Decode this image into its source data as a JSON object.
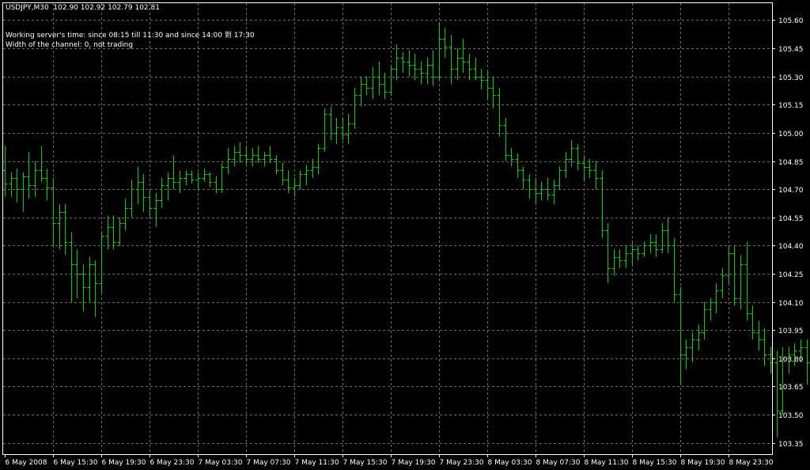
{
  "header": {
    "symbol_line": "USDJPY,M30  102.90 102.92 102.79 102.81",
    "server_time_line": "Working server's time: since 08:15 till 11:30 and since 14:00 到 17:30",
    "channel_line": "Width of the channel: 0, not trading"
  },
  "colors": {
    "background": "#000000",
    "grid": "#6b6b6b",
    "bars": "#00d000",
    "text": "#ffffff",
    "frame": "#ffffff"
  },
  "chart_data": {
    "type": "ohlc",
    "symbol": "USDJPY",
    "timeframe": "M30",
    "grid": true,
    "y_axis_side": "right",
    "ylim": [
      103.29,
      105.69
    ],
    "y_ticks": [
      "105.60",
      "105.45",
      "105.30",
      "105.15",
      "105.00",
      "104.85",
      "104.70",
      "104.55",
      "104.40",
      "104.25",
      "104.10",
      "103.95",
      "103.80",
      "103.65",
      "103.50",
      "103.35"
    ],
    "x_ticks": [
      "6 May 2008",
      "6 May 15:30",
      "6 May 19:30",
      "6 May 23:30",
      "7 May 03:30",
      "7 May 07:30",
      "7 May 11:30",
      "7 May 15:30",
      "7 May 19:30",
      "7 May 23:30",
      "8 May 03:30",
      "8 May 07:30",
      "8 May 11:30",
      "8 May 15:30",
      "8 May 19:30",
      "8 May 23:30"
    ],
    "bars_per_tick": 8,
    "bars": [
      [
        104.8,
        104.93,
        104.66,
        104.73
      ],
      [
        104.73,
        104.79,
        104.66,
        104.76
      ],
      [
        104.76,
        104.81,
        104.63,
        104.7
      ],
      [
        104.7,
        104.79,
        104.58,
        104.77
      ],
      [
        104.77,
        104.9,
        104.65,
        104.72
      ],
      [
        104.72,
        104.85,
        104.66,
        104.8
      ],
      [
        104.8,
        104.93,
        104.74,
        104.76
      ],
      [
        104.76,
        104.81,
        104.64,
        104.71
      ],
      [
        104.71,
        104.76,
        104.4,
        104.52
      ],
      [
        104.52,
        104.62,
        104.38,
        104.58
      ],
      [
        104.58,
        104.62,
        104.35,
        104.42
      ],
      [
        104.42,
        104.47,
        104.1,
        104.3
      ],
      [
        104.3,
        104.38,
        104.12,
        104.25
      ],
      [
        104.25,
        104.3,
        104.05,
        104.18
      ],
      [
        104.18,
        104.34,
        104.1,
        104.3
      ],
      [
        104.3,
        104.32,
        104.02,
        104.2
      ],
      [
        104.2,
        104.47,
        104.15,
        104.45
      ],
      [
        104.45,
        104.56,
        104.38,
        104.5
      ],
      [
        104.5,
        104.56,
        104.38,
        104.42
      ],
      [
        104.42,
        104.55,
        104.4,
        104.52
      ],
      [
        104.52,
        104.65,
        104.48,
        104.6
      ],
      [
        104.6,
        104.75,
        104.55,
        104.7
      ],
      [
        104.7,
        104.82,
        104.62,
        104.74
      ],
      [
        104.74,
        104.78,
        104.58,
        104.66
      ],
      [
        104.66,
        104.7,
        104.55,
        104.6
      ],
      [
        104.6,
        104.68,
        104.5,
        104.64
      ],
      [
        104.64,
        104.76,
        104.6,
        104.72
      ],
      [
        104.72,
        104.79,
        104.64,
        104.76
      ],
      [
        104.76,
        104.88,
        104.7,
        104.74
      ],
      [
        104.74,
        104.8,
        104.68,
        104.76
      ],
      [
        104.76,
        104.8,
        104.72,
        104.78
      ],
      [
        104.78,
        104.8,
        104.73,
        104.75
      ],
      [
        104.75,
        104.79,
        104.69,
        104.76
      ],
      [
        104.76,
        104.81,
        104.74,
        104.78
      ],
      [
        104.78,
        104.79,
        104.71,
        104.74
      ],
      [
        104.74,
        104.77,
        104.68,
        104.7
      ],
      [
        104.7,
        104.84,
        104.68,
        104.82
      ],
      [
        104.82,
        104.92,
        104.78,
        104.86
      ],
      [
        104.86,
        104.93,
        104.82,
        104.9
      ],
      [
        104.9,
        104.95,
        104.84,
        104.88
      ],
      [
        104.88,
        104.93,
        104.83,
        104.86
      ],
      [
        104.86,
        104.92,
        104.82,
        104.88
      ],
      [
        104.88,
        104.93,
        104.84,
        104.86
      ],
      [
        104.86,
        104.9,
        104.82,
        104.88
      ],
      [
        104.88,
        104.93,
        104.84,
        104.86
      ],
      [
        104.86,
        104.88,
        104.78,
        104.8
      ],
      [
        104.8,
        104.84,
        104.72,
        104.75
      ],
      [
        104.75,
        104.8,
        104.68,
        104.71
      ],
      [
        104.71,
        104.76,
        104.66,
        104.72
      ],
      [
        104.72,
        104.8,
        104.7,
        104.78
      ],
      [
        104.78,
        104.83,
        104.72,
        104.8
      ],
      [
        104.8,
        104.86,
        104.76,
        104.82
      ],
      [
        104.82,
        104.94,
        104.78,
        104.92
      ],
      [
        104.92,
        105.13,
        104.9,
        105.1
      ],
      [
        105.1,
        105.14,
        104.96,
        105.0
      ],
      [
        105.0,
        105.08,
        104.94,
        105.03
      ],
      [
        105.03,
        105.08,
        104.96,
        104.99
      ],
      [
        104.99,
        105.1,
        104.94,
        105.05
      ],
      [
        105.05,
        105.24,
        105.02,
        105.2
      ],
      [
        105.2,
        105.3,
        105.14,
        105.26
      ],
      [
        105.26,
        105.3,
        105.2,
        105.24
      ],
      [
        105.24,
        105.35,
        105.18,
        105.3
      ],
      [
        105.3,
        105.38,
        105.2,
        105.26
      ],
      [
        105.26,
        105.32,
        105.18,
        105.22
      ],
      [
        105.22,
        105.36,
        105.2,
        105.34
      ],
      [
        105.34,
        105.47,
        105.28,
        105.4
      ],
      [
        105.4,
        105.43,
        105.32,
        105.38
      ],
      [
        105.38,
        105.44,
        105.3,
        105.36
      ],
      [
        105.36,
        105.42,
        105.28,
        105.34
      ],
      [
        105.34,
        105.38,
        105.26,
        105.32
      ],
      [
        105.32,
        105.4,
        105.26,
        105.36
      ],
      [
        105.36,
        105.44,
        105.25,
        105.3
      ],
      [
        105.3,
        105.59,
        105.28,
        105.5
      ],
      [
        105.5,
        105.56,
        105.4,
        105.46
      ],
      [
        105.46,
        105.52,
        105.26,
        105.34
      ],
      [
        105.34,
        105.45,
        105.28,
        105.4
      ],
      [
        105.4,
        105.5,
        105.32,
        105.38
      ],
      [
        105.38,
        105.42,
        105.28,
        105.34
      ],
      [
        105.34,
        105.4,
        105.28,
        105.3
      ],
      [
        105.3,
        105.34,
        105.23,
        105.28
      ],
      [
        105.28,
        105.33,
        105.18,
        105.24
      ],
      [
        105.24,
        105.3,
        105.13,
        105.2
      ],
      [
        105.2,
        105.24,
        104.98,
        105.04
      ],
      [
        105.04,
        105.08,
        104.85,
        104.88
      ],
      [
        104.88,
        104.92,
        104.82,
        104.86
      ],
      [
        104.86,
        104.89,
        104.76,
        104.8
      ],
      [
        104.8,
        104.82,
        104.7,
        104.75
      ],
      [
        104.75,
        104.78,
        104.65,
        104.7
      ],
      [
        104.7,
        104.76,
        104.62,
        104.68
      ],
      [
        104.68,
        104.74,
        104.64,
        104.7
      ],
      [
        104.7,
        104.76,
        104.64,
        104.67
      ],
      [
        104.67,
        104.75,
        104.62,
        104.72
      ],
      [
        104.72,
        104.82,
        104.7,
        104.8
      ],
      [
        104.8,
        104.9,
        104.76,
        104.86
      ],
      [
        104.86,
        104.96,
        104.82,
        104.92
      ],
      [
        104.92,
        104.94,
        104.8,
        104.84
      ],
      [
        104.84,
        104.88,
        104.74,
        104.82
      ],
      [
        104.82,
        104.86,
        104.76,
        104.8
      ],
      [
        104.8,
        104.85,
        104.7,
        104.76
      ],
      [
        104.76,
        104.8,
        104.44,
        104.48
      ],
      [
        104.48,
        104.52,
        104.2,
        104.28
      ],
      [
        104.28,
        104.38,
        104.24,
        104.34
      ],
      [
        104.34,
        104.38,
        104.28,
        104.32
      ],
      [
        104.32,
        104.4,
        104.28,
        104.36
      ],
      [
        104.36,
        104.42,
        104.3,
        104.38
      ],
      [
        104.38,
        104.4,
        104.32,
        104.36
      ],
      [
        104.36,
        104.42,
        104.34,
        104.4
      ],
      [
        104.4,
        104.46,
        104.36,
        104.42
      ],
      [
        104.42,
        104.46,
        104.34,
        104.38
      ],
      [
        104.38,
        104.52,
        104.36,
        104.48
      ],
      [
        104.48,
        104.55,
        104.36,
        104.4
      ],
      [
        104.4,
        104.44,
        104.1,
        104.14
      ],
      [
        104.14,
        104.18,
        103.66,
        103.82
      ],
      [
        103.82,
        103.9,
        103.74,
        103.86
      ],
      [
        103.86,
        103.94,
        103.78,
        103.9
      ],
      [
        103.9,
        103.98,
        103.84,
        103.94
      ],
      [
        103.94,
        104.1,
        103.9,
        104.06
      ],
      [
        104.06,
        104.12,
        104.0,
        104.1
      ],
      [
        104.1,
        104.2,
        104.04,
        104.16
      ],
      [
        104.16,
        104.28,
        104.12,
        104.24
      ],
      [
        104.24,
        104.4,
        104.2,
        104.36
      ],
      [
        104.36,
        104.4,
        104.08,
        104.12
      ],
      [
        104.12,
        104.35,
        104.06,
        104.3
      ],
      [
        104.3,
        104.42,
        104.0,
        104.04
      ],
      [
        104.04,
        104.08,
        103.9,
        103.94
      ],
      [
        103.94,
        104.0,
        103.84,
        103.9
      ],
      [
        103.9,
        103.96,
        103.76,
        103.82
      ],
      [
        103.82,
        103.86,
        103.72,
        103.78
      ],
      [
        103.78,
        103.84,
        103.38,
        103.52
      ],
      [
        103.52,
        103.86,
        103.5,
        103.8
      ],
      [
        103.8,
        103.86,
        103.72,
        103.82
      ],
      [
        103.82,
        103.88,
        103.76,
        103.84
      ],
      [
        103.84,
        103.9,
        103.78,
        103.86
      ],
      [
        103.86,
        103.9,
        103.66,
        103.78
      ],
      [
        103.78,
        103.86,
        103.72,
        103.8
      ],
      [
        103.8,
        103.92,
        103.76,
        103.88
      ],
      [
        103.88,
        103.98,
        103.84,
        103.94
      ],
      [
        103.94,
        104.08,
        103.88,
        104.02
      ],
      [
        104.02,
        104.06,
        103.9,
        103.96
      ],
      [
        103.96,
        104.08,
        103.92,
        104.02
      ],
      [
        104.02,
        104.06,
        103.9,
        103.96
      ],
      [
        103.96,
        104.02,
        103.88,
        103.94
      ],
      [
        103.94,
        103.98,
        103.66,
        103.68
      ],
      [
        103.68,
        103.76,
        103.62,
        103.72
      ],
      [
        103.72,
        103.8,
        103.64,
        103.76
      ],
      [
        103.76,
        103.8,
        103.7,
        103.78
      ]
    ]
  }
}
